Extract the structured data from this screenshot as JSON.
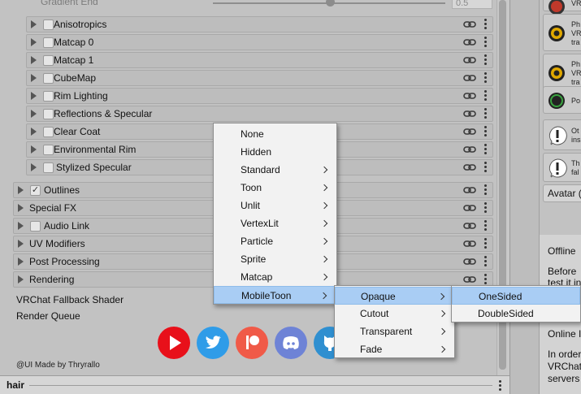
{
  "inspector": {
    "gradient_label": "Gradient End",
    "gradient_value": "0.5",
    "gradient_slider_level": 0.5,
    "subsections": [
      {
        "label": "Anisotropics",
        "checked": false
      },
      {
        "label": "Matcap 0",
        "checked": false
      },
      {
        "label": "Matcap 1",
        "checked": false
      },
      {
        "label": "CubeMap",
        "checked": false
      },
      {
        "label": "Rim Lighting",
        "checked": false
      },
      {
        "label": "Reflections & Specular",
        "checked": false
      },
      {
        "label": "Clear Coat",
        "checked": false
      },
      {
        "label": "Environmental Rim",
        "checked": false
      },
      {
        "label": "Stylized Specular",
        "checked": false
      }
    ],
    "sections": [
      {
        "label": "Outlines",
        "checkbox": true,
        "checked": true
      },
      {
        "label": "Special FX",
        "checkbox": false
      },
      {
        "label": "Audio Link",
        "checkbox": true,
        "checked": false
      },
      {
        "label": "UV Modifiers",
        "checkbox": false
      },
      {
        "label": "Post Processing",
        "checkbox": false
      },
      {
        "label": "Rendering",
        "checkbox": false
      }
    ],
    "fallback_label": "VRChat Fallback Shader",
    "render_queue_label": "Render Queue",
    "credit": "@UI Made by Thryrallo",
    "social_icons": [
      {
        "name": "youtube-icon",
        "color": "#e8101a"
      },
      {
        "name": "twitter-icon",
        "color": "#2f9ce8"
      },
      {
        "name": "patreon-icon",
        "color": "#f05a48"
      },
      {
        "name": "discord-icon",
        "color": "#6e83d6"
      },
      {
        "name": "github-icon",
        "color": "#2f8fd0"
      }
    ]
  },
  "bottom_bar": {
    "title": "hair"
  },
  "menus": {
    "level1": [
      {
        "label": "None",
        "submenu": false
      },
      {
        "label": "Hidden",
        "submenu": false
      },
      {
        "label": "Standard",
        "submenu": true
      },
      {
        "label": "Toon",
        "submenu": true
      },
      {
        "label": "Unlit",
        "submenu": true
      },
      {
        "label": "VertexLit",
        "submenu": true
      },
      {
        "label": "Particle",
        "submenu": true
      },
      {
        "label": "Sprite",
        "submenu": true
      },
      {
        "label": "Matcap",
        "submenu": true
      },
      {
        "label": "MobileToon",
        "submenu": true,
        "highlighted": true
      }
    ],
    "level2": [
      {
        "label": "Opaque",
        "submenu": true,
        "highlighted": true
      },
      {
        "label": "Cutout",
        "submenu": true
      },
      {
        "label": "Transparent",
        "submenu": true
      },
      {
        "label": "Fade",
        "submenu": true
      }
    ],
    "level3": [
      {
        "label": "OneSided",
        "highlighted": true
      },
      {
        "label": "DoubleSided"
      }
    ]
  },
  "right_panel": {
    "cards": [
      {
        "icon": "error-icon",
        "color": "#c0392b",
        "lines": [
          "VR"
        ]
      },
      {
        "icon": "warning-circle-icon",
        "color": "#e0a800",
        "lines": [
          "Ph",
          "VR",
          "tra"
        ]
      },
      {
        "icon": "warning-circle-icon",
        "color": "#e0a800",
        "lines": [
          "Ph",
          "VR",
          "tra"
        ]
      },
      {
        "icon": "ok-circle-icon",
        "color": "#3aa340",
        "lines": [
          "Po"
        ]
      },
      {
        "icon": "info-icon",
        "color": "#ffffff",
        "lines": [
          "Ot",
          "ins"
        ]
      },
      {
        "icon": "info-icon",
        "color": "#ffffff",
        "lines": [
          "Th",
          "fal"
        ]
      }
    ],
    "button_label": "Avatar (",
    "lower_lines": [
      "Offline",
      "Before",
      "test it in",
      "Online I",
      "In order",
      "VRChat",
      "servers"
    ]
  }
}
